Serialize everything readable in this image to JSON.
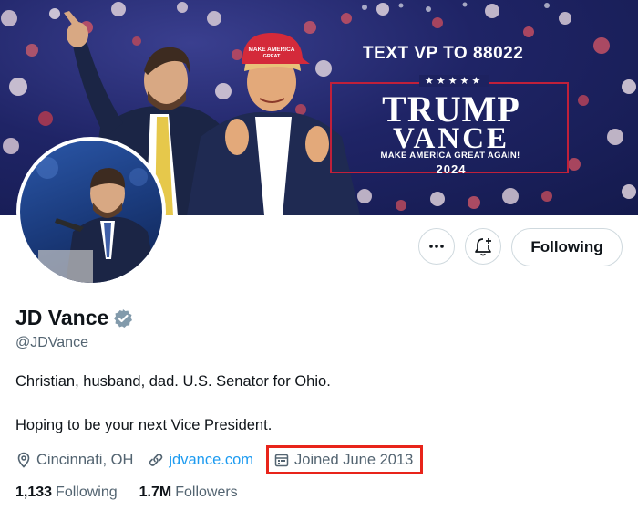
{
  "banner": {
    "cta_text": "TEXT VP TO 88022",
    "stars": "★★★★★",
    "logo_line1": "TRUMP",
    "logo_line2": "VANCE",
    "slogan": "MAKE AMERICA GREAT AGAIN!",
    "year": "2024",
    "hat_text": "MAKE AMERICA GREAT"
  },
  "actions": {
    "more_icon": "more-horizontal-icon",
    "notify_icon": "bell-plus-icon",
    "follow_label": "Following"
  },
  "profile": {
    "name": "JD Vance",
    "handle": "@JDVance",
    "verified": true,
    "bio_line1": "Christian, husband, dad. U.S. Senator for Ohio.",
    "bio_line2": "Hoping to be your next Vice President.",
    "location": "Cincinnati, OH",
    "website": "jdvance.com",
    "joined": "Joined June 2013"
  },
  "stats": {
    "following_count": "1,133",
    "following_label": "Following",
    "followers_count": "1.7M",
    "followers_label": "Followers"
  },
  "colors": {
    "link": "#1d9bf0",
    "secondary_text": "#536471",
    "highlight_box": "#e8241a",
    "verified_badge": "#829aab"
  }
}
